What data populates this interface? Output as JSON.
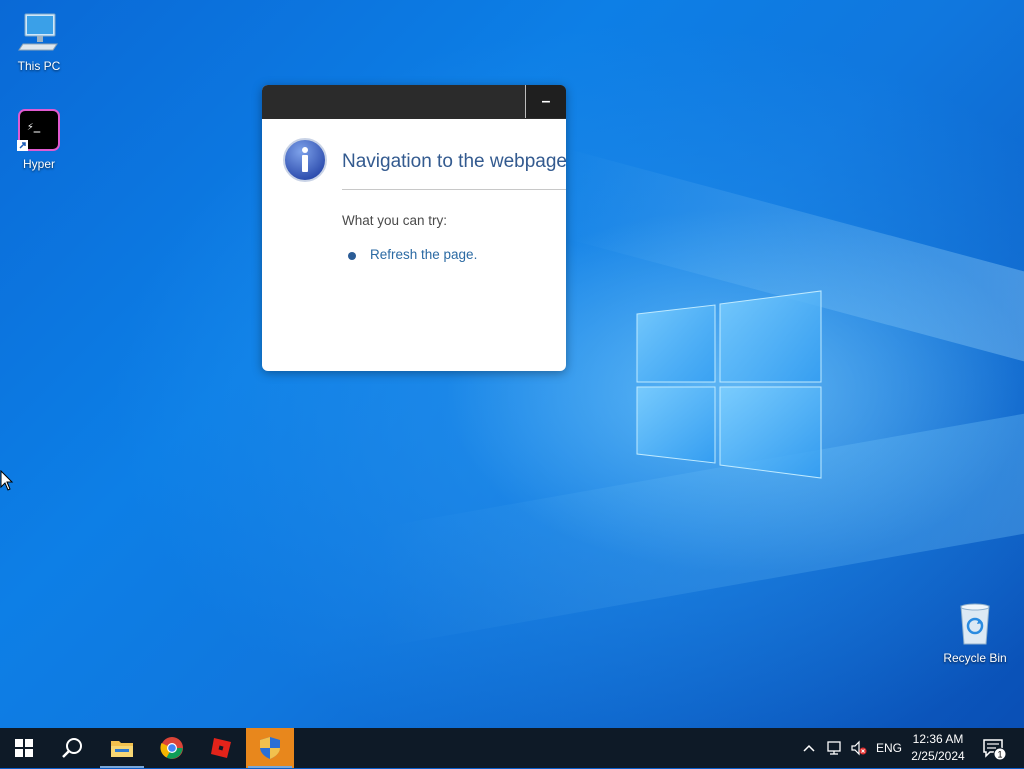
{
  "desktop": {
    "icons": [
      {
        "label": "This PC",
        "icon": "computer-icon"
      },
      {
        "label": "Hyper",
        "icon": "terminal-app-icon"
      },
      {
        "label": "Recycle Bin",
        "icon": "recycle-bin-icon"
      }
    ]
  },
  "dialog": {
    "minimize_label": "–",
    "title_text": "Navigation to the webpage was canceled",
    "try_label": "What you can try:",
    "refresh_link": "Refresh the page.",
    "icon": "info-icon"
  },
  "taskbar": {
    "apps": [
      {
        "name": "start-button",
        "icon": "windows-icon"
      },
      {
        "name": "search-button",
        "icon": "search-icon"
      },
      {
        "name": "file-explorer-button",
        "icon": "folder-icon"
      },
      {
        "name": "chrome-button",
        "icon": "chrome-icon"
      },
      {
        "name": "roblox-button",
        "icon": "roblox-icon"
      },
      {
        "name": "security-shield-button",
        "icon": "shield-icon"
      }
    ],
    "tray": {
      "language": "ENG",
      "time": "12:36 AM",
      "date": "2/25/2024",
      "notification_count": "1"
    }
  },
  "colors": {
    "desktop_blue": "#0a69d6",
    "taskbar": "#0e1a27",
    "dialog_title_bar": "#2b2b2b",
    "link": "#2b6aa3",
    "highlight": "#e8871c"
  }
}
